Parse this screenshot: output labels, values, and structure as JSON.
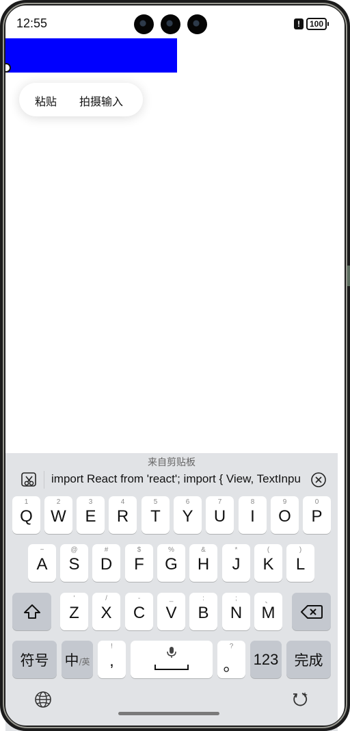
{
  "status_bar": {
    "time": "12:55",
    "alert_glyph": "!",
    "battery": "100"
  },
  "context_menu": {
    "paste": "粘贴",
    "camera_input": "拍摄输入"
  },
  "clipboard": {
    "title": "来自剪贴板",
    "text": "import React from 'react'; import { View, TextInput } from 'react-native';"
  },
  "keyboard": {
    "row1": [
      {
        "hint": "1",
        "label": "Q"
      },
      {
        "hint": "2",
        "label": "W"
      },
      {
        "hint": "3",
        "label": "E"
      },
      {
        "hint": "4",
        "label": "R"
      },
      {
        "hint": "5",
        "label": "T"
      },
      {
        "hint": "6",
        "label": "Y"
      },
      {
        "hint": "7",
        "label": "U"
      },
      {
        "hint": "8",
        "label": "I"
      },
      {
        "hint": "9",
        "label": "O"
      },
      {
        "hint": "0",
        "label": "P"
      }
    ],
    "row2": [
      {
        "hint": "~",
        "label": "A"
      },
      {
        "hint": "@",
        "label": "S"
      },
      {
        "hint": "#",
        "label": "D"
      },
      {
        "hint": "$",
        "label": "F"
      },
      {
        "hint": "%",
        "label": "G"
      },
      {
        "hint": "&",
        "label": "H"
      },
      {
        "hint": "*",
        "label": "J"
      },
      {
        "hint": "(",
        "label": "K"
      },
      {
        "hint": ")",
        "label": "L"
      }
    ],
    "row3": [
      {
        "hint": "'",
        "label": "Z"
      },
      {
        "hint": "/",
        "label": "X"
      },
      {
        "hint": "-",
        "label": "C"
      },
      {
        "hint": "_",
        "label": "V"
      },
      {
        "hint": ":",
        "label": "B"
      },
      {
        "hint": ";",
        "label": "N"
      },
      {
        "hint": "、",
        "label": "M"
      }
    ],
    "symbols": "符号",
    "lang_main": "中",
    "lang_sub": "/英",
    "comma_hint": "!",
    "comma": ",",
    "period_hint": "?",
    "period": "。",
    "numbers": "123",
    "done": "完成"
  },
  "icons": {
    "clipboard_manage": "scissors-clipboard-icon",
    "clipboard_close": "close-circle-icon",
    "shift": "shift-arrow-icon",
    "backspace": "backspace-icon",
    "mic": "microphone-icon",
    "globe": "globe-icon",
    "refresh": "refresh-sparkle-icon"
  },
  "colors": {
    "highlight_box": "#0000ff",
    "keyboard_bg": "#e1e3e6",
    "function_key": "#c4c8cf"
  }
}
